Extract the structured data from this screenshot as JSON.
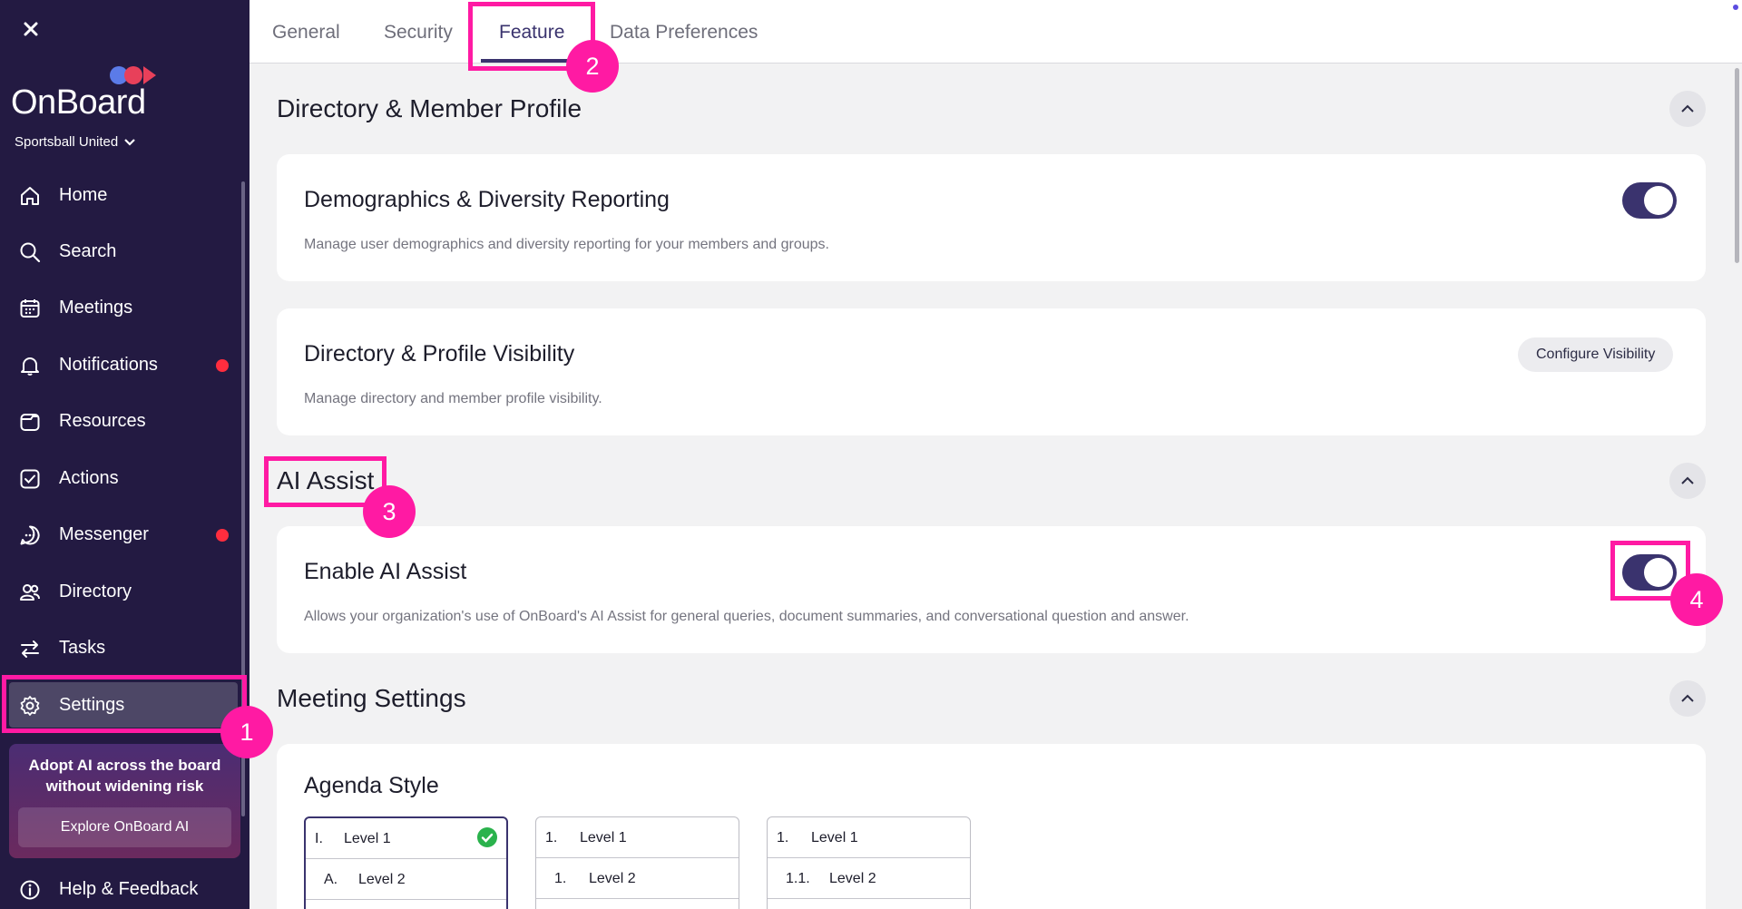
{
  "sidebar": {
    "brand": "OnBoard",
    "org": "Sportsball United",
    "nav": [
      {
        "label": "Home",
        "icon": "home-icon"
      },
      {
        "label": "Search",
        "icon": "search-icon"
      },
      {
        "label": "Meetings",
        "icon": "calendar-icon"
      },
      {
        "label": "Notifications",
        "icon": "bell-icon",
        "badge": true
      },
      {
        "label": "Resources",
        "icon": "folder-icon"
      },
      {
        "label": "Actions",
        "icon": "checkbox-icon"
      },
      {
        "label": "Messenger",
        "icon": "chat-icon",
        "badge": true
      },
      {
        "label": "Directory",
        "icon": "people-icon"
      },
      {
        "label": "Tasks",
        "icon": "swap-arrows-icon"
      },
      {
        "label": "Settings",
        "icon": "gear-icon",
        "active": true
      }
    ],
    "promo": {
      "line1": "Adopt AI across the board",
      "line2": "without widening risk",
      "button": "Explore OnBoard AI"
    },
    "help": "Help & Feedback"
  },
  "tabs": [
    {
      "label": "General"
    },
    {
      "label": "Security"
    },
    {
      "label": "Feature",
      "active": true
    },
    {
      "label": "Data Preferences"
    }
  ],
  "sections": {
    "directory": {
      "title": "Directory & Member Profile",
      "demographics": {
        "title": "Demographics & Diversity Reporting",
        "desc": "Manage user demographics and diversity reporting for your members and groups.",
        "enabled": true
      },
      "visibility": {
        "title": "Directory & Profile Visibility",
        "desc": "Manage directory and member profile visibility.",
        "button": "Configure Visibility"
      }
    },
    "ai": {
      "title": "AI Assist",
      "enable": {
        "title": "Enable AI Assist",
        "desc": "Allows your organization's use of OnBoard's AI Assist for general queries, document summaries, and conversational question and answer.",
        "enabled": true
      }
    },
    "meeting": {
      "title": "Meeting Settings",
      "agenda": {
        "title": "Agenda Style",
        "options": [
          {
            "l1_num": "I.",
            "l1": "Level 1",
            "l2_num": "A.",
            "l2": "Level 2",
            "selected": true
          },
          {
            "l1_num": "1.",
            "l1": "Level 1",
            "l2_num": "1.",
            "l2": "Level 2",
            "selected": false
          },
          {
            "l1_num": "1.",
            "l1": "Level 1",
            "l2_num": "1.1.",
            "l2": "Level 2",
            "selected": false
          }
        ]
      }
    }
  },
  "annotations": [
    "1",
    "2",
    "3",
    "4"
  ],
  "colors": {
    "sidebar_bg": "#231a42",
    "accent": "#3a336e",
    "annotation": "#ff1aa3",
    "badge": "#ff2d3e",
    "check": "#2ab24c"
  }
}
